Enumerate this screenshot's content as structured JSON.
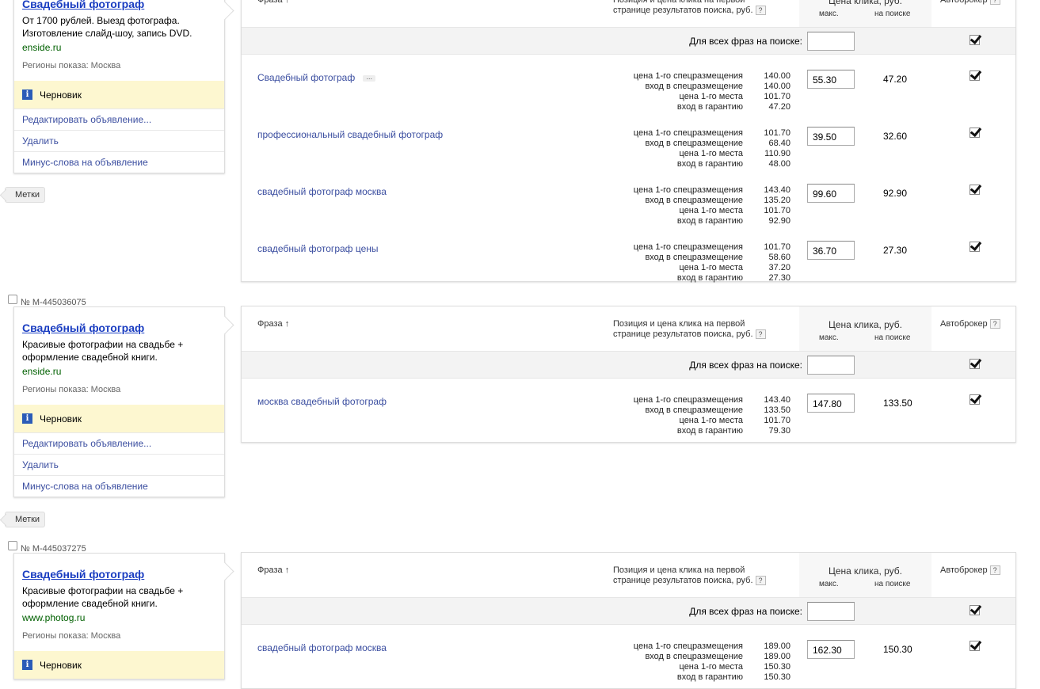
{
  "labels": {
    "phrase": "Фраза",
    "position": "Позиция и цена клика на первой",
    "position2": "странице результатов поиска, руб.",
    "help": "?",
    "price": "Цена клика, руб.",
    "max": "макс.",
    "on_search": "на поиске",
    "autobroker": "Автоброкер",
    "all_phrases": "Для всех фраз на поиске:",
    "draft": "Черновик",
    "edit": "Редактировать объявление...",
    "delete": "Удалить",
    "minus": "Минус-слова на объявление",
    "tags": "Метки",
    "regions": "Регионы показа: Москва",
    "bid_labels": [
      "цена 1-го спецразмещения",
      "вход в спецразмещение",
      "цена 1-го места",
      "вход в гарантию"
    ]
  },
  "groups": [
    {
      "ad_id": "",
      "title": "Свадебный фотограф",
      "text": "От 1700 рублей. Выезд фотографа. Изготовление слайд-шоу, запись DVD.",
      "domain": "enside.ru",
      "phrases": [
        {
          "phrase": "Свадебный фотограф",
          "has_more": true,
          "bids": [
            "140.00",
            "140.00",
            "101.70",
            "47.20"
          ],
          "max": "55.30",
          "search": "47.20"
        },
        {
          "phrase": "профессиональный свадебный фотограф",
          "bids": [
            "101.70",
            "68.40",
            "110.90",
            "48.00"
          ],
          "max": "39.50",
          "search": "32.60"
        },
        {
          "phrase": "свадебный фотограф москва",
          "bids": [
            "143.40",
            "135.20",
            "101.70",
            "92.90"
          ],
          "max": "99.60",
          "search": "92.90"
        },
        {
          "phrase": "свадебный фотограф цены",
          "bids": [
            "101.70",
            "58.60",
            "37.20",
            "27.30"
          ],
          "max": "36.70",
          "search": "27.30"
        }
      ]
    },
    {
      "ad_id": "№ M-445036075",
      "title": "Свадебный фотограф",
      "text": "Красивые фотографии на свадьбе + оформление свадебной книги.",
      "domain": "enside.ru",
      "phrases": [
        {
          "phrase": "москва свадебный фотограф",
          "bids": [
            "143.40",
            "133.50",
            "101.70",
            "79.30"
          ],
          "max": "147.80",
          "search": "133.50"
        }
      ]
    },
    {
      "ad_id": "№ M-445037275",
      "title": "Свадебный фотограф",
      "text": "Красивые фотографии на свадьбе + оформление свадебной книги.",
      "domain": "www.photog.ru",
      "phrases": [
        {
          "phrase": "свадебный фотограф москва",
          "bids": [
            "189.00",
            "189.00",
            "150.30",
            "150.30"
          ],
          "max": "162.30",
          "search": "150.30"
        }
      ]
    }
  ]
}
